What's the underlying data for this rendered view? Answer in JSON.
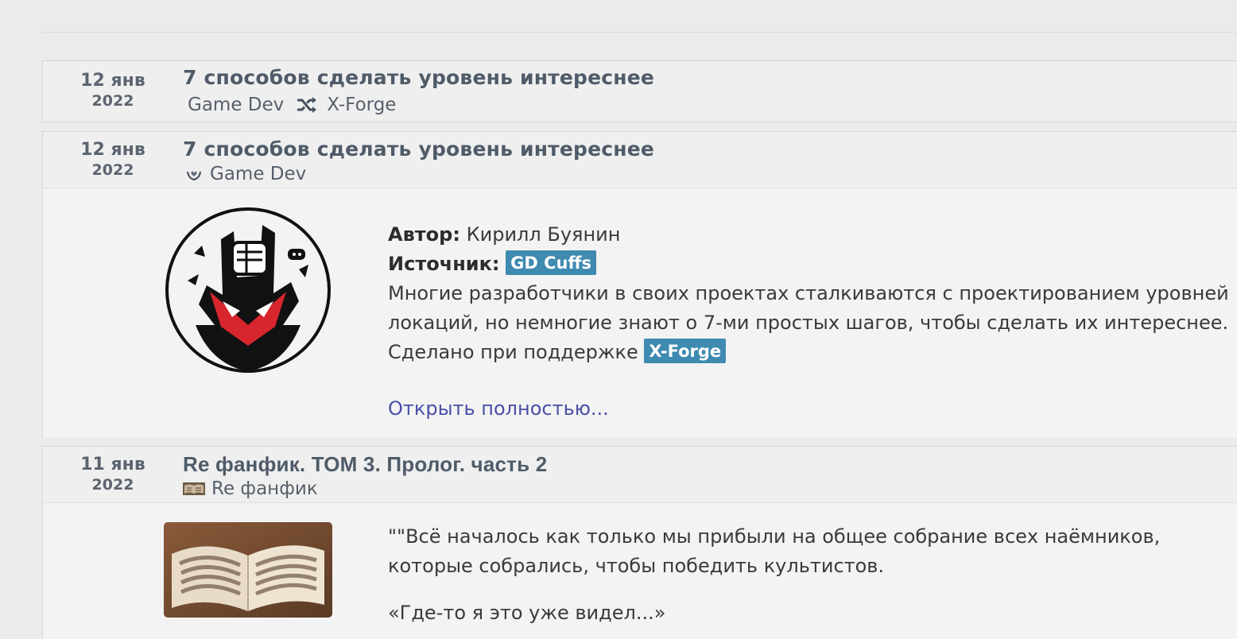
{
  "posts": [
    {
      "date": "12 янв",
      "year": "2022",
      "title": "7 способов сделать уровень интереснее",
      "category": "Game Dev",
      "repost_icon": "shuffle-icon",
      "repost_source": "X-Forge"
    },
    {
      "date": "12 янв",
      "year": "2022",
      "title": "7 способов сделать уровень интереснее",
      "category_icon": "gamedev-logo-icon",
      "category": "Game Dev",
      "author_label": "Автор:",
      "author": "Кирилл Буянин",
      "source_label": "Источник:",
      "source_tag": "GD Cuffs",
      "description_line1": "Многие разработчики в своих проектах сталкиваются с проектированием уровней",
      "description_line2": "локаций, но немногие знают о 7-ми простых шагов, чтобы сделать их интереснее.",
      "support_text": "Сделано при поддержке",
      "support_tag": "X-Forge",
      "open_link": "Открыть полностью..."
    },
    {
      "date": "11 янв",
      "year": "2022",
      "title": "Re фанфик. ТОМ 3. Пролог. часть 2",
      "category_icon": "book-thumbnail-icon",
      "category": "Re фанфик",
      "excerpt_line1": "\"\"Всё началось как только мы прибыли на общее собрание всех наёмников,",
      "excerpt_line2": "которые собрались, чтобы победить культистов.",
      "excerpt_line3": "«Где-то я это уже видел...»"
    }
  ],
  "colors": {
    "tag_bg": "#3e8ab0",
    "link": "#4a4ea6",
    "title": "#4f5b68",
    "logo_red": "#d8262e"
  }
}
